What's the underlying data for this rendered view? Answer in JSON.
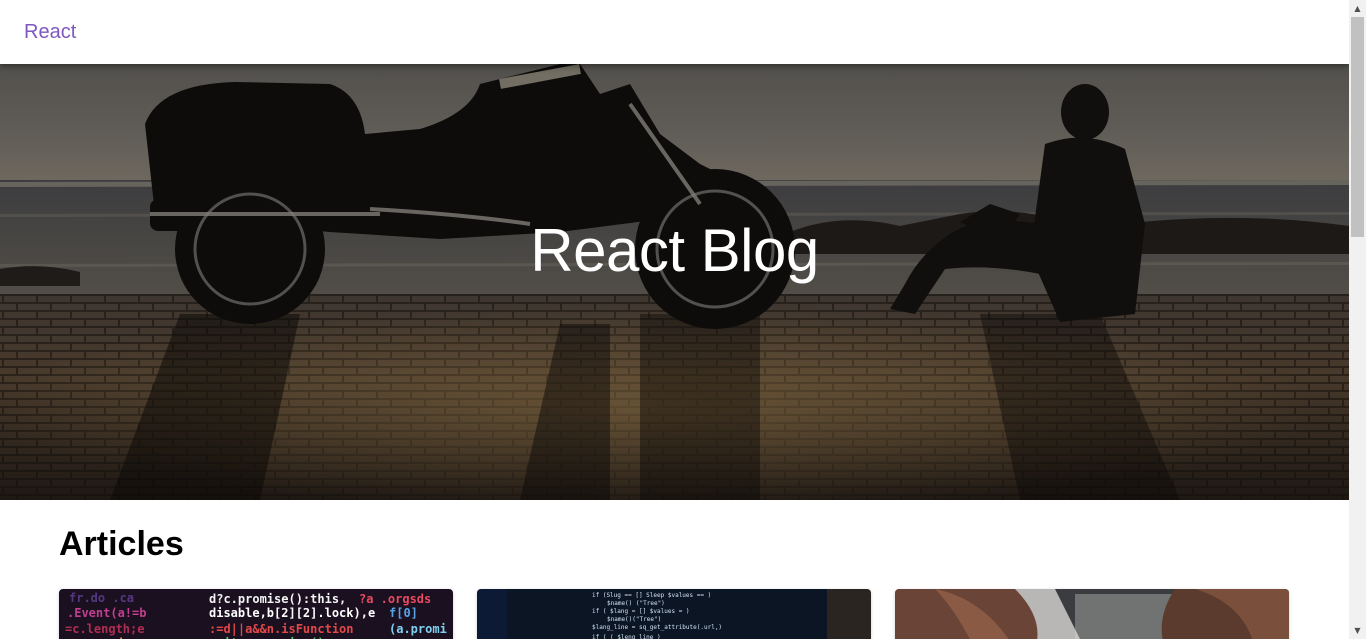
{
  "app_bar": {
    "brand": "React",
    "brand_color": "#7e57c2"
  },
  "hero": {
    "title": "React Blog",
    "image": "motorcycle-beach-sunset"
  },
  "articles": {
    "heading": "Articles",
    "cards": [
      {
        "image": "colorful-code-screen"
      },
      {
        "image": "laptop-code-screen"
      },
      {
        "image": "people-at-laptop"
      }
    ]
  },
  "icons": {
    "scroll_up": "▲",
    "scroll_down": "▼"
  }
}
